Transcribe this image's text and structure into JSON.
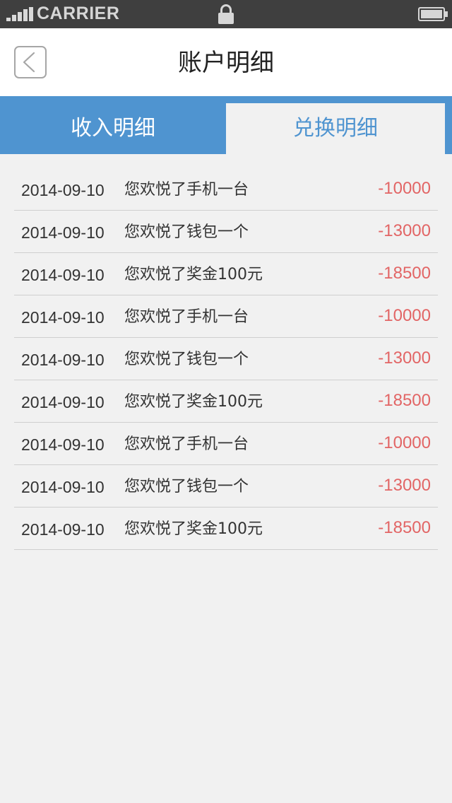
{
  "status_bar": {
    "carrier": "CARRIER"
  },
  "header": {
    "title": "账户明细"
  },
  "tabs": [
    {
      "label": "收入明细",
      "active": true
    },
    {
      "label": "兑换明细",
      "active": false
    }
  ],
  "colors": {
    "accent": "#4f94d0",
    "negative_amount": "#e26565"
  },
  "records": [
    {
      "date": "2014-09-10",
      "description": "您欢悦了手机一台",
      "amount": "-10000"
    },
    {
      "date": "2014-09-10",
      "description": "您欢悦了钱包一个",
      "amount": "-13000"
    },
    {
      "date": "2014-09-10",
      "description": "您欢悦了奖金100元",
      "amount": "-18500"
    },
    {
      "date": "2014-09-10",
      "description": "您欢悦了手机一台",
      "amount": "-10000"
    },
    {
      "date": "2014-09-10",
      "description": "您欢悦了钱包一个",
      "amount": "-13000"
    },
    {
      "date": "2014-09-10",
      "description": "您欢悦了奖金100元",
      "amount": "-18500"
    },
    {
      "date": "2014-09-10",
      "description": "您欢悦了手机一台",
      "amount": "-10000"
    },
    {
      "date": "2014-09-10",
      "description": "您欢悦了钱包一个",
      "amount": "-13000"
    },
    {
      "date": "2014-09-10",
      "description": "您欢悦了奖金100元",
      "amount": "-18500"
    }
  ]
}
